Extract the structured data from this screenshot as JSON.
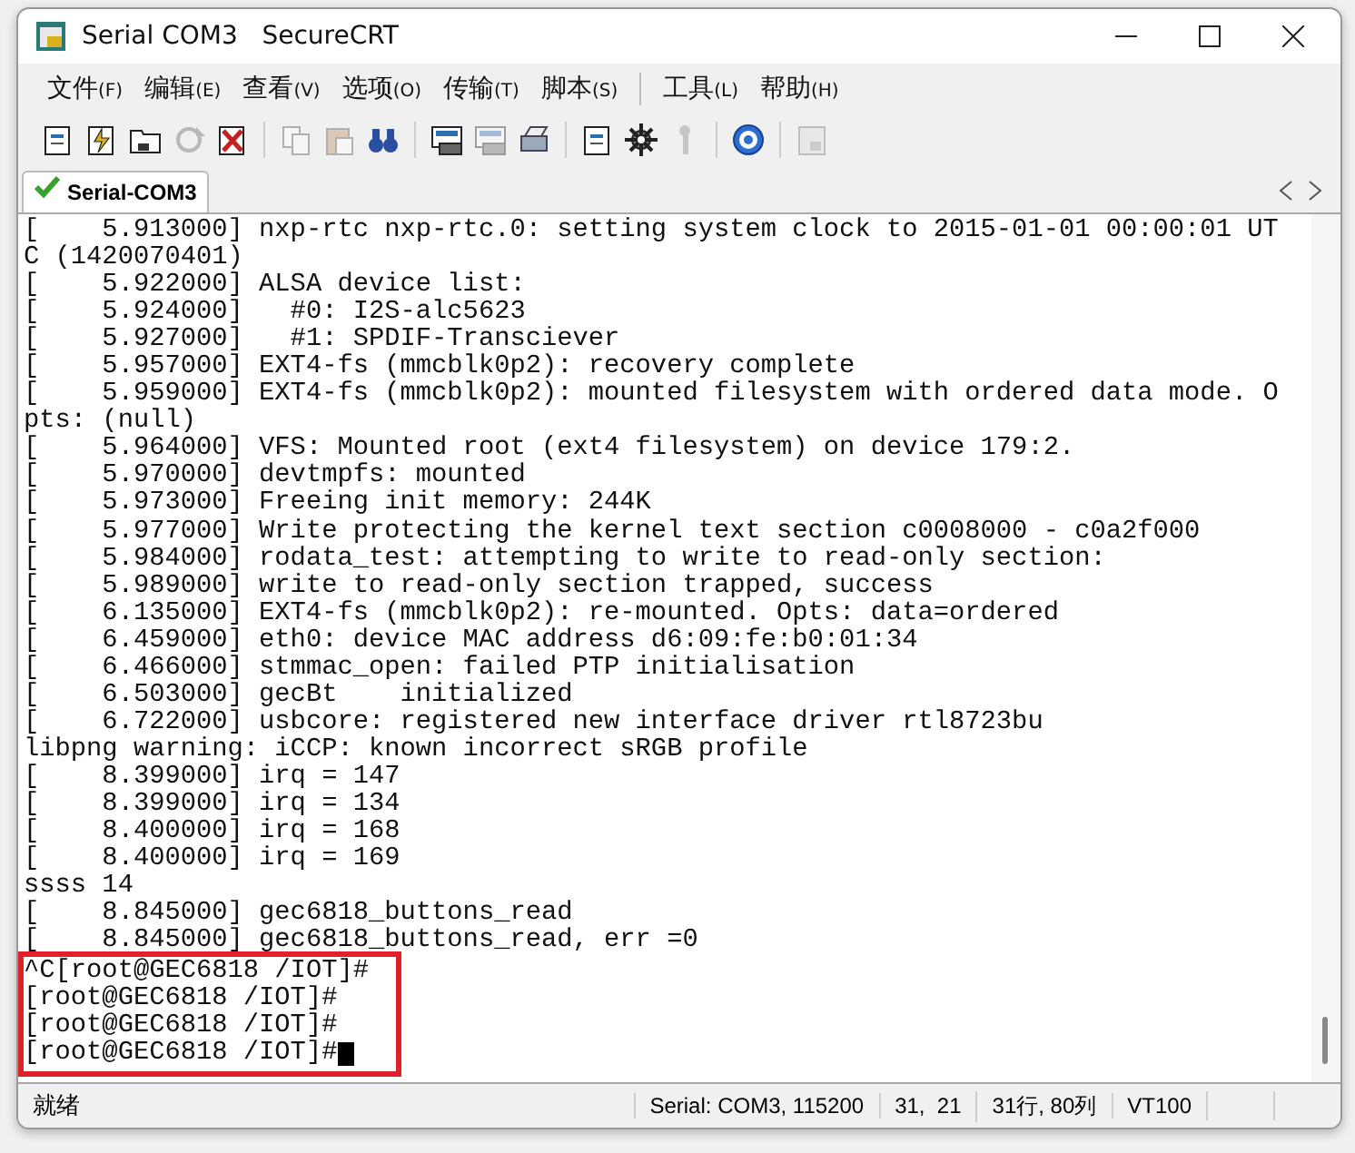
{
  "window": {
    "title": "Serial COM3   SecureCRT"
  },
  "menu": [
    {
      "label": "文件",
      "key": "(F)",
      "separator_before": false
    },
    {
      "label": "编辑",
      "key": "(E)",
      "separator_before": false
    },
    {
      "label": "查看",
      "key": "(V)",
      "separator_before": false
    },
    {
      "label": "选项",
      "key": "(O)",
      "separator_before": false
    },
    {
      "label": "传输",
      "key": "(T)",
      "separator_before": false
    },
    {
      "label": "脚本",
      "key": "(S)",
      "separator_before": false
    },
    {
      "label": "工具",
      "key": "(L)",
      "separator_before": true
    },
    {
      "label": "帮助",
      "key": "(H)",
      "separator_before": false
    }
  ],
  "toolbar": [
    [
      {
        "kind": "page",
        "disabled": false
      },
      {
        "kind": "bolt",
        "disabled": false
      },
      {
        "kind": "folder",
        "disabled": false
      },
      {
        "kind": "refresh",
        "disabled": true
      },
      {
        "kind": "cross",
        "disabled": false
      }
    ],
    [
      {
        "kind": "copy",
        "disabled": true
      },
      {
        "kind": "paste",
        "disabled": true
      },
      {
        "kind": "binoculars",
        "disabled": false
      }
    ],
    [
      {
        "kind": "screen",
        "disabled": false
      },
      {
        "kind": "screen",
        "disabled": true
      },
      {
        "kind": "printer",
        "disabled": false
      }
    ],
    [
      {
        "kind": "page",
        "disabled": false
      },
      {
        "kind": "gear",
        "disabled": false
      },
      {
        "kind": "key",
        "disabled": true
      }
    ],
    [
      {
        "kind": "help",
        "disabled": false
      }
    ],
    [
      {
        "kind": "lock",
        "disabled": true
      }
    ]
  ],
  "tabs": [
    {
      "label": "Serial-COM3",
      "selected": true,
      "connected": true
    }
  ],
  "terminal": {
    "lines": [
      "[    5.913000] nxp-rtc nxp-rtc.0: setting system clock to 2015-01-01 00:00:01 UT",
      "C (1420070401)",
      "[    5.922000] ALSA device list:",
      "[    5.924000]   #0: I2S-alc5623",
      "[    5.927000]   #1: SPDIF-Transciever",
      "[    5.957000] EXT4-fs (mmcblk0p2): recovery complete",
      "[    5.959000] EXT4-fs (mmcblk0p2): mounted filesystem with ordered data mode. O",
      "pts: (null)",
      "[    5.964000] VFS: Mounted root (ext4 filesystem) on device 179:2.",
      "[    5.970000] devtmpfs: mounted",
      "[    5.973000] Freeing init memory: 244K",
      "[    5.977000] Write protecting the kernel text section c0008000 - c0a2f000",
      "[    5.984000] rodata_test: attempting to write to read-only section:",
      "[    5.989000] write to read-only section trapped, success",
      "[    6.135000] EXT4-fs (mmcblk0p2): re-mounted. Opts: data=ordered",
      "[    6.459000] eth0: device MAC address d6:09:fe:b0:01:34",
      "[    6.466000] stmmac_open: failed PTP initialisation",
      "[    6.503000] gecBt    initialized",
      "[    6.722000] usbcore: registered new interface driver rtl8723bu",
      "libpng warning: iCCP: known incorrect sRGB profile",
      "[    8.399000] irq = 147",
      "[    8.399000] irq = 134",
      "[    8.400000] irq = 168",
      "[    8.400000] irq = 169",
      "ssss 14",
      "[    8.845000] gec6818_buttons_read",
      "[    8.845000] gec6818_buttons_read, err =0"
    ],
    "highlighted_lines": [
      "^C[root@GEC6818 /IOT]#",
      "[root@GEC6818 /IOT]#",
      "[root@GEC6818 /IOT]#",
      "[root@GEC6818 /IOT]#"
    ],
    "cursor": true
  },
  "status_bar": [
    "就绪",
    "Serial: COM3, 115200",
    "31,  21",
    "31行, 80列",
    "VT100"
  ]
}
